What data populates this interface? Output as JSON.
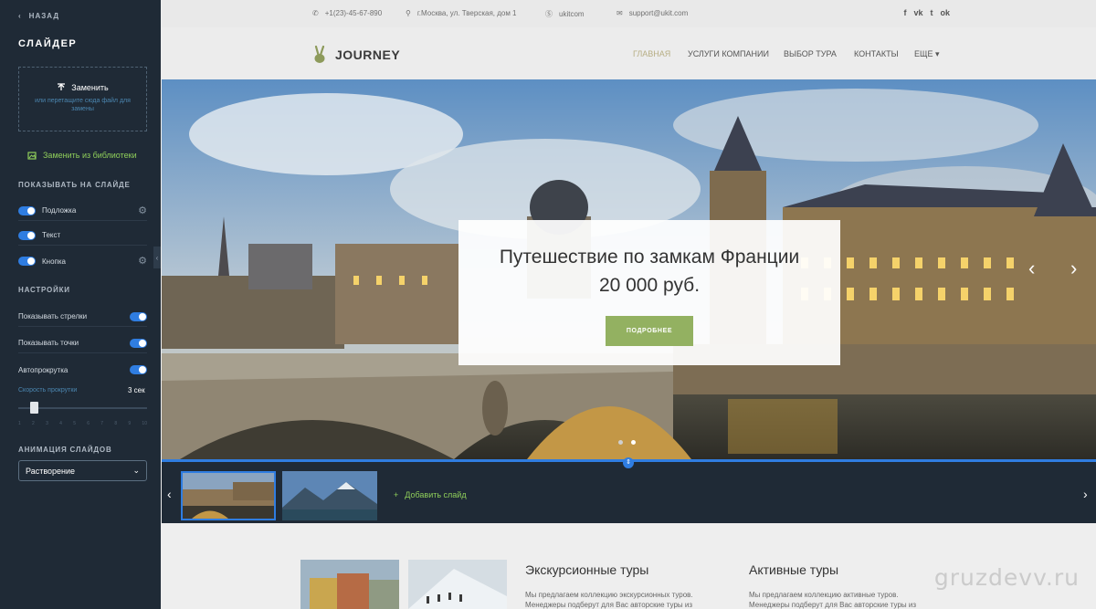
{
  "panel": {
    "back_label": "НАЗАД",
    "title": "СЛАЙДЕР",
    "replace_label": "Заменить",
    "replace_hint": "или перетащите сюда файл для замены",
    "library_label": "Заменить из библиотеки",
    "show_section": "ПОКАЗЫВАТЬ НА СЛАЙДЕ",
    "show_items": [
      {
        "label": "Подложка",
        "on": true
      },
      {
        "label": "Текст",
        "on": true
      },
      {
        "label": "Кнопка",
        "on": true
      }
    ],
    "settings_section": "НАСТРОЙКИ",
    "settings_items": [
      {
        "label": "Показывать стрелки",
        "on": true
      },
      {
        "label": "Показывать точки",
        "on": true
      },
      {
        "label": "Автопрокрутка",
        "on": true
      }
    ],
    "speed_label": "Скорость прокрутки",
    "speed_value": "3 сек",
    "speed_ticks": [
      "1",
      "2",
      "3",
      "4",
      "5",
      "6",
      "7",
      "8",
      "9",
      "10"
    ],
    "animation_section": "АНИМАЦИЯ СЛАЙДОВ",
    "animation_value": "Растворение"
  },
  "topbar": {
    "phone": "+1(23)-45-67-890",
    "address": "г.Москва, ул. Тверская, дом 1",
    "skype": "ukitcom",
    "email": "support@ukit.com",
    "social": [
      "f",
      "vk",
      "t",
      "ok"
    ]
  },
  "nav": {
    "logo": "JOURNEY",
    "items": [
      "ГЛАВНАЯ",
      "УСЛУГИ КОМПАНИИ",
      "ВЫБОР ТУРА",
      "КОНТАКТЫ",
      "ЕЩЕ"
    ]
  },
  "slide": {
    "title_line1": "Путешествие по замкам Франции",
    "title_line2": "20 000 руб.",
    "button": "ПОДРОБНЕЕ"
  },
  "thumbs": {
    "add_label": "Добавить слайд"
  },
  "lower": {
    "card1_title": "Экскурсионные туры",
    "card1_text": "Мы предлагаем коллекцию экскурсионных туров. Менеджеры подберут для Вас авторские туры из",
    "card2_title": "Активные туры",
    "card2_text": "Мы предлагаем коллекцию активные туров. Менеджеры подберут для Вас авторские туры из",
    "watermark": "gruzdevv.ru"
  },
  "colors": {
    "panel_bg": "#1f2a36",
    "accent_blue": "#2f7de1",
    "accent_green": "#8fce5a",
    "button_green": "#93b161"
  }
}
